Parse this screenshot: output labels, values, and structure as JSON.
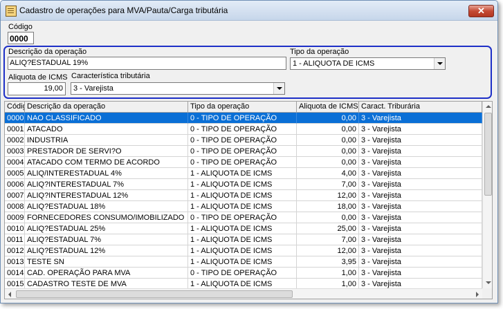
{
  "window": {
    "title": "Cadastro de operações para MVA/Pauta/Carga tributária",
    "close_label": "✕"
  },
  "form": {
    "codigo_label": "Código",
    "codigo_value": "0000",
    "descricao_label": "Descrição da operação",
    "descricao_value": "ALIQ?ESTADUAL 19%",
    "tipo_label": "Tipo da operação",
    "tipo_value": "1 - ALIQUOTA DE ICMS",
    "aliquota_label": "Aliquota de ICMS",
    "aliquota_value": "19,00",
    "caracteristica_label": "Característica tributária",
    "caracteristica_value": "3 - Varejista"
  },
  "grid": {
    "columns": [
      "Código",
      "Descrição da operação",
      "Tipo da operação",
      "Aliquota de ICMS",
      "Caract. Triburária"
    ],
    "rows": [
      [
        "0000",
        "NAO CLASSIFICADO",
        "0 - TIPO DE OPERAÇÃO",
        "0,00",
        "3 - Varejista"
      ],
      [
        "0001",
        "ATACADO",
        "0 - TIPO DE OPERAÇÃO",
        "0,00",
        "3 - Varejista"
      ],
      [
        "0002",
        "INDUSTRIA",
        "0 - TIPO DE OPERAÇÃO",
        "0,00",
        "3 - Varejista"
      ],
      [
        "0003",
        "PRESTADOR DE SERVI?O",
        "0 - TIPO DE OPERAÇÃO",
        "0,00",
        "3 - Varejista"
      ],
      [
        "0004",
        "ATACADO COM TERMO DE ACORDO",
        "0 - TIPO DE OPERAÇÃO",
        "0,00",
        "3 - Varejista"
      ],
      [
        "0005",
        "ALIQ/INTERESTADUAL 4%",
        "1 - ALIQUOTA DE ICMS",
        "4,00",
        "3 - Varejista"
      ],
      [
        "0006",
        "ALIQ?INTERESTADUAL 7%",
        "1 - ALIQUOTA DE ICMS",
        "7,00",
        "3 - Varejista"
      ],
      [
        "0007",
        "ALIQ?INTERESTADUAL 12%",
        "1 - ALIQUOTA DE ICMS",
        "12,00",
        "3 - Varejista"
      ],
      [
        "0008",
        "ALIQ?ESTADUAL 18%",
        "1 - ALIQUOTA DE ICMS",
        "18,00",
        "3 - Varejista"
      ],
      [
        "0009",
        "FORNECEDORES CONSUMO/IMOBILIZADO",
        "0 - TIPO DE OPERAÇÃO",
        "0,00",
        "3 - Varejista"
      ],
      [
        "0010",
        "ALIQ?ESTADUAL 25%",
        "1 - ALIQUOTA DE ICMS",
        "25,00",
        "3 - Varejista"
      ],
      [
        "0011",
        "ALIQ?ESTADUAL 7%",
        "1 - ALIQUOTA DE ICMS",
        "7,00",
        "3 - Varejista"
      ],
      [
        "0012",
        "ALIQ?ESTADUAL 12%",
        "1 - ALIQUOTA DE ICMS",
        "12,00",
        "3 - Varejista"
      ],
      [
        "0013",
        "TESTE SN",
        "1 - ALIQUOTA DE ICMS",
        "3,95",
        "3 - Varejista"
      ],
      [
        "0014",
        "CAD. OPERAÇÃO PARA MVA",
        "0 - TIPO DE OPERAÇÃO",
        "1,00",
        "3 - Varejista"
      ],
      [
        "0015",
        "CADASTRO TESTE DE MVA",
        "1 - ALIQUOTA DE ICMS",
        "1,00",
        "3 - Varejista"
      ]
    ]
  }
}
